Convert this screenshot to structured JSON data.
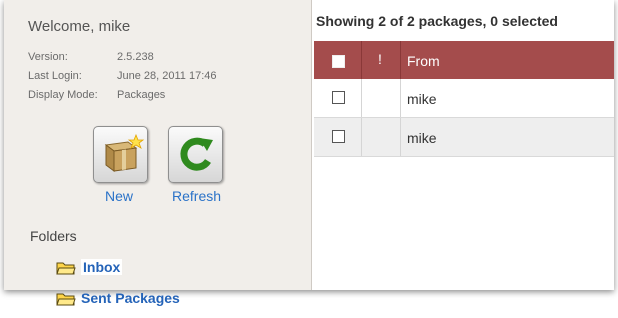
{
  "sidebar": {
    "welcome": "Welcome, mike",
    "info": [
      {
        "label": "Version:",
        "value": "2.5.238"
      },
      {
        "label": "Last Login:",
        "value": "June 28, 2011 17:46"
      },
      {
        "label": "Display Mode:",
        "value": "Packages"
      }
    ],
    "buttons": {
      "new_label": "New",
      "refresh_label": "Refresh"
    },
    "folders_heading": "Folders",
    "folders": [
      {
        "label": "Inbox",
        "selected": true
      },
      {
        "label": "Sent Packages",
        "selected": false
      }
    ]
  },
  "main": {
    "status": "Showing 2 of 2 packages, 0 selected",
    "columns": {
      "flag": "!",
      "from": "From"
    },
    "rows": [
      {
        "from": "mike"
      },
      {
        "from": "mike"
      }
    ]
  },
  "colors": {
    "header_bg": "#a44c4c",
    "link": "#2463b8"
  },
  "icons": [
    "package-icon",
    "refresh-icon",
    "folder-icon"
  ]
}
